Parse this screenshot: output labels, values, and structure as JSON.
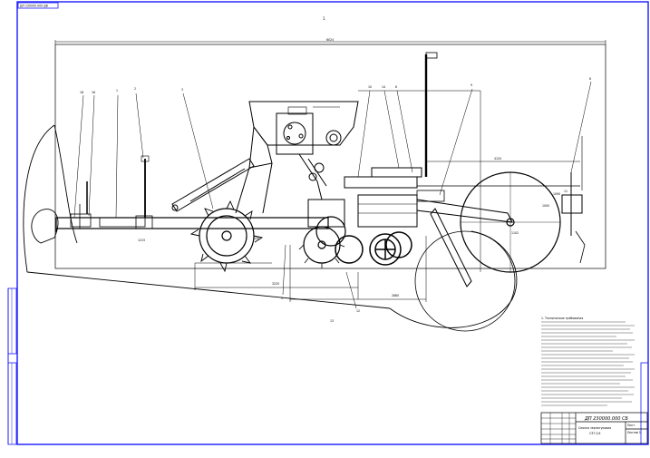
{
  "drawing": {
    "corner_code": "ДП 230000.000 ДВ",
    "sheet_mark": "1",
    "overall_dimension": "6024",
    "dimension_right_top": "4120",
    "dimension_right_axle": "1000",
    "dimension_bottom_left": "3220",
    "dimension_bottom_mid": "2880",
    "dimension_frame_left": "1215",
    "dimension_wheel": "1102",
    "dimension_small_a": "120",
    "dimension_small_b": "1090",
    "position_labels": [
      "18",
      "16",
      "1",
      "2",
      "3",
      "10",
      "14",
      "6",
      "9",
      "8",
      "5",
      "12",
      "13",
      "11"
    ],
    "notes_header": "1. Технические требования",
    "title_block": {
      "designation": "ДП 230000.000 СБ",
      "name": "Сеялка зернотуковая",
      "name_line2": "СЗТ-3,6",
      "sheet": "Лист",
      "sheets": "Листов 1"
    },
    "colors": {
      "border": "#1a1aff",
      "lines": "#000000"
    }
  }
}
